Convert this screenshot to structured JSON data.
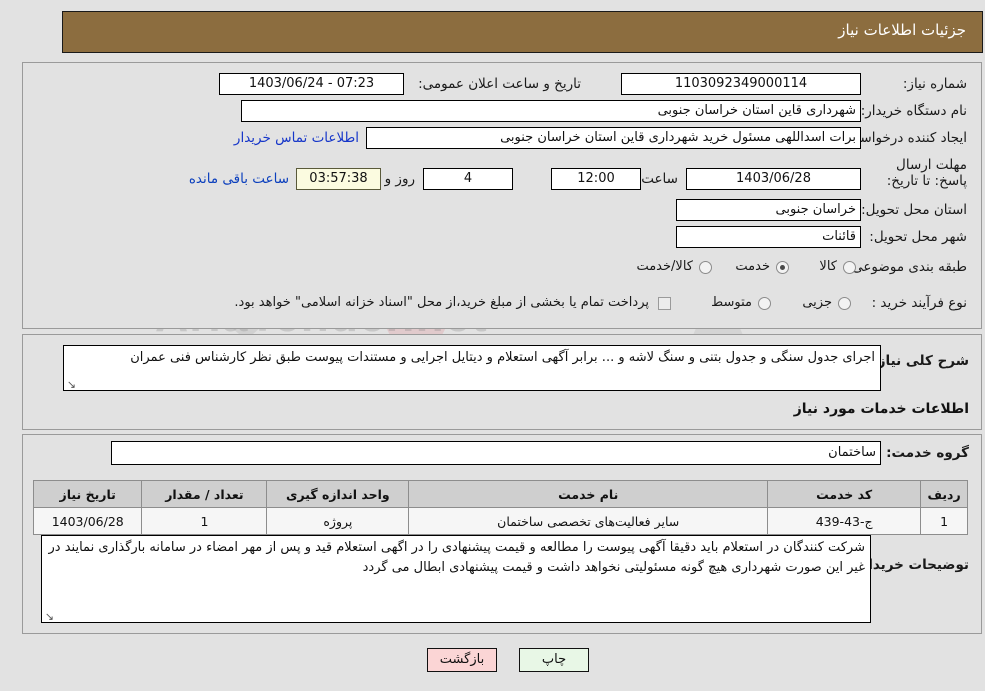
{
  "header": {
    "title": "جزئیات اطلاعات نیاز"
  },
  "main": {
    "need_number_label": "شماره نیاز:",
    "need_number_value": "1103092349000114",
    "announce_datetime_label": "تاریخ و ساعت اعلان عمومی:",
    "announce_datetime_value": "07:23 - 1403/06/24",
    "buyer_org_label": "نام دستگاه خریدار:",
    "buyer_org_value": "شهرداری قاین استان خراسان جنوبی",
    "creator_label": "ایجاد کننده درخواست:",
    "creator_value": "برات اسداللهی مسئول خرید شهرداری قاین استان خراسان جنوبی",
    "contact_link": "اطلاعات تماس خریدار",
    "deadline_label": "مهلت ارسال پاسخ: تا تاریخ:",
    "deadline_date": "1403/06/28",
    "deadline_hour_label": "ساعت",
    "deadline_hour_value": "12:00",
    "remaining_days": "4",
    "remaining_days_unit": "روز و",
    "remaining_time": "03:57:38",
    "remaining_suffix": "ساعت باقی مانده",
    "province_label": "استان محل تحویل:",
    "province_value": "خراسان جنوبی",
    "city_label": "شهر محل تحویل:",
    "city_value": "قائنات",
    "category_label": "طبقه بندی موضوعی:",
    "category_options": [
      {
        "label": "کالا",
        "checked": false
      },
      {
        "label": "خدمت",
        "checked": true
      },
      {
        "label": "کالا/خدمت",
        "checked": false
      }
    ],
    "process_label": "نوع فرآیند خرید :",
    "process_options": [
      {
        "label": "جزیی",
        "checked": false
      },
      {
        "label": "متوسط",
        "checked": false
      }
    ],
    "treasury_note": "پرداخت تمام یا بخشی از مبلغ خرید،از محل \"اسناد خزانه اسلامی\" خواهد بود."
  },
  "description": {
    "label": "شرح کلی نیاز:",
    "value": "اجرای جدول سنگی و جدول بتنی و سنگ لاشه و ... برابر  آگهی استعلام و دیتایل اجرایی و مستندات پیوست طبق نظر کارشناس فنی عمران"
  },
  "services": {
    "section_title": "اطلاعات خدمات مورد نیاز",
    "service_group_label": "گروه خدمت:",
    "service_group_value": "ساختمان",
    "table": {
      "columns": [
        "ردیف",
        "کد خدمت",
        "نام خدمت",
        "واحد اندازه گیری",
        "تعداد / مقدار",
        "تاریخ نیاز"
      ],
      "rows": [
        [
          "1",
          "ج-43-439",
          "سایر فعالیت‌های تخصصی ساختمان",
          "پروژه",
          "1",
          "1403/06/28"
        ]
      ]
    },
    "buyer_notes_label": "توضیحات خریدار:",
    "buyer_notes_value": "شرکت کنندگان در استعلام باید دقیقا آگهی پیوست را مطالعه و قیمت پیشنهادی را در اگهی استعلام قید و پس از مهر امضاء در سامانه بارگذاری نمایند در غیر این صورت شهرداری هیچ گونه مسئولیتی نخواهد داشت و قیمت پیشنهادی ابطال می گردد"
  },
  "footer": {
    "print_label": "چاپ",
    "back_label": "بازگشت"
  },
  "watermark": {
    "text": "AriaTender.net"
  },
  "colors": {
    "header_bg": "#8c6d3f",
    "page_bg": "#e2e2e2",
    "link": "#1636c9",
    "print_btn": "#e8f7e6",
    "back_btn": "#fbd5d5",
    "countdown_bg": "#fbfbe0"
  }
}
